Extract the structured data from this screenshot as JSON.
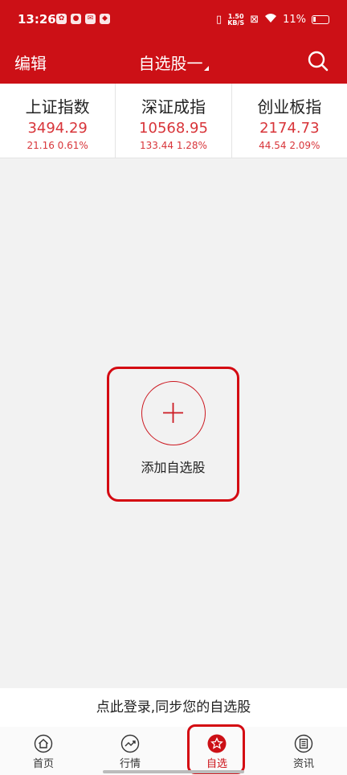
{
  "status_bar": {
    "time": "13:26",
    "net_speed_value": "1.50",
    "net_speed_unit": "KB/S",
    "battery": "11%"
  },
  "header": {
    "edit_label": "编辑",
    "title": "自选股一",
    "search_icon": "search-icon"
  },
  "indices": [
    {
      "name": "上证指数",
      "value": "3494.29",
      "change": "21.16  0.61%"
    },
    {
      "name": "深证成指",
      "value": "10568.95",
      "change": "133.44  1.28%"
    },
    {
      "name": "创业板指",
      "value": "2174.73",
      "change": "44.54  2.09%"
    }
  ],
  "add": {
    "label": "添加自选股",
    "icon": "plus-icon"
  },
  "login_prompt": "点此登录,同步您的自选股",
  "tabs": [
    {
      "label": "首页",
      "icon": "home-icon"
    },
    {
      "label": "行情",
      "icon": "trend-icon"
    },
    {
      "label": "自选",
      "icon": "star-icon",
      "active": true
    },
    {
      "label": "资讯",
      "icon": "news-icon"
    }
  ],
  "colors": {
    "brand_red": "#cc1016",
    "price_up": "#d8353a",
    "highlight_outline": "#d40a12"
  }
}
